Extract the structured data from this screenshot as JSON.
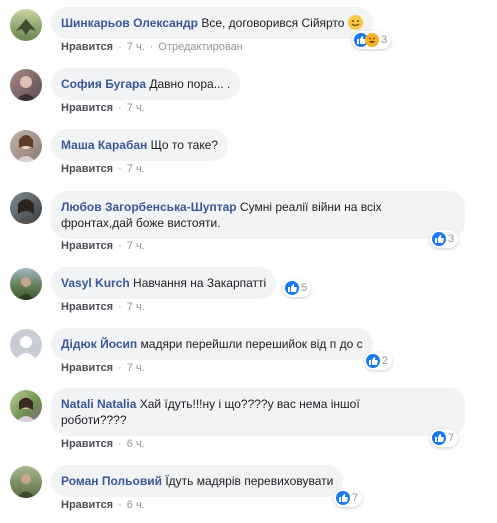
{
  "like_label": "Нравится",
  "edited_label": "Отредактирован",
  "comments": [
    {
      "author": "Шинкарьов Олександр",
      "text": "Все, договорився Сійярто",
      "time": "7 ч.",
      "reactions": "3",
      "emoji": "smiley"
    },
    {
      "author": "София Бугара",
      "text": "Давно пора... .",
      "time": "7 ч."
    },
    {
      "author": "Маша Карабан",
      "text": "Що то таке?",
      "time": "7 ч."
    },
    {
      "author": "Любов Загорбенська-Шуптар",
      "text": "Сумні реалії війни на всіх",
      "text2": "фронтах,дай боже вистояти.",
      "time": "7 ч.",
      "reactions": "3"
    },
    {
      "author": "Vasyl Kurch",
      "text": "Навчання на Закарпатті",
      "time": "7 ч.",
      "reactions": "5"
    },
    {
      "author": "Дідюк Йосип",
      "text": "мадяри перейшли перешийок від п до с",
      "time": "7 ч.",
      "reactions": "2"
    },
    {
      "author": "Natali Natalia",
      "text": "Хай їдуть!!!ну і що????у вас нема іншої",
      "text2": "роботи????",
      "time": "6 ч.",
      "reactions": "7"
    },
    {
      "author": "Роман Польовий",
      "text": "Їдуть мадярів перевиховувати",
      "time": "6 ч.",
      "reactions": "7"
    }
  ],
  "colors": {
    "author": "#385898",
    "bubble": "#f2f3f5",
    "like_blue": "#1877f2",
    "meta": "#90949c"
  }
}
